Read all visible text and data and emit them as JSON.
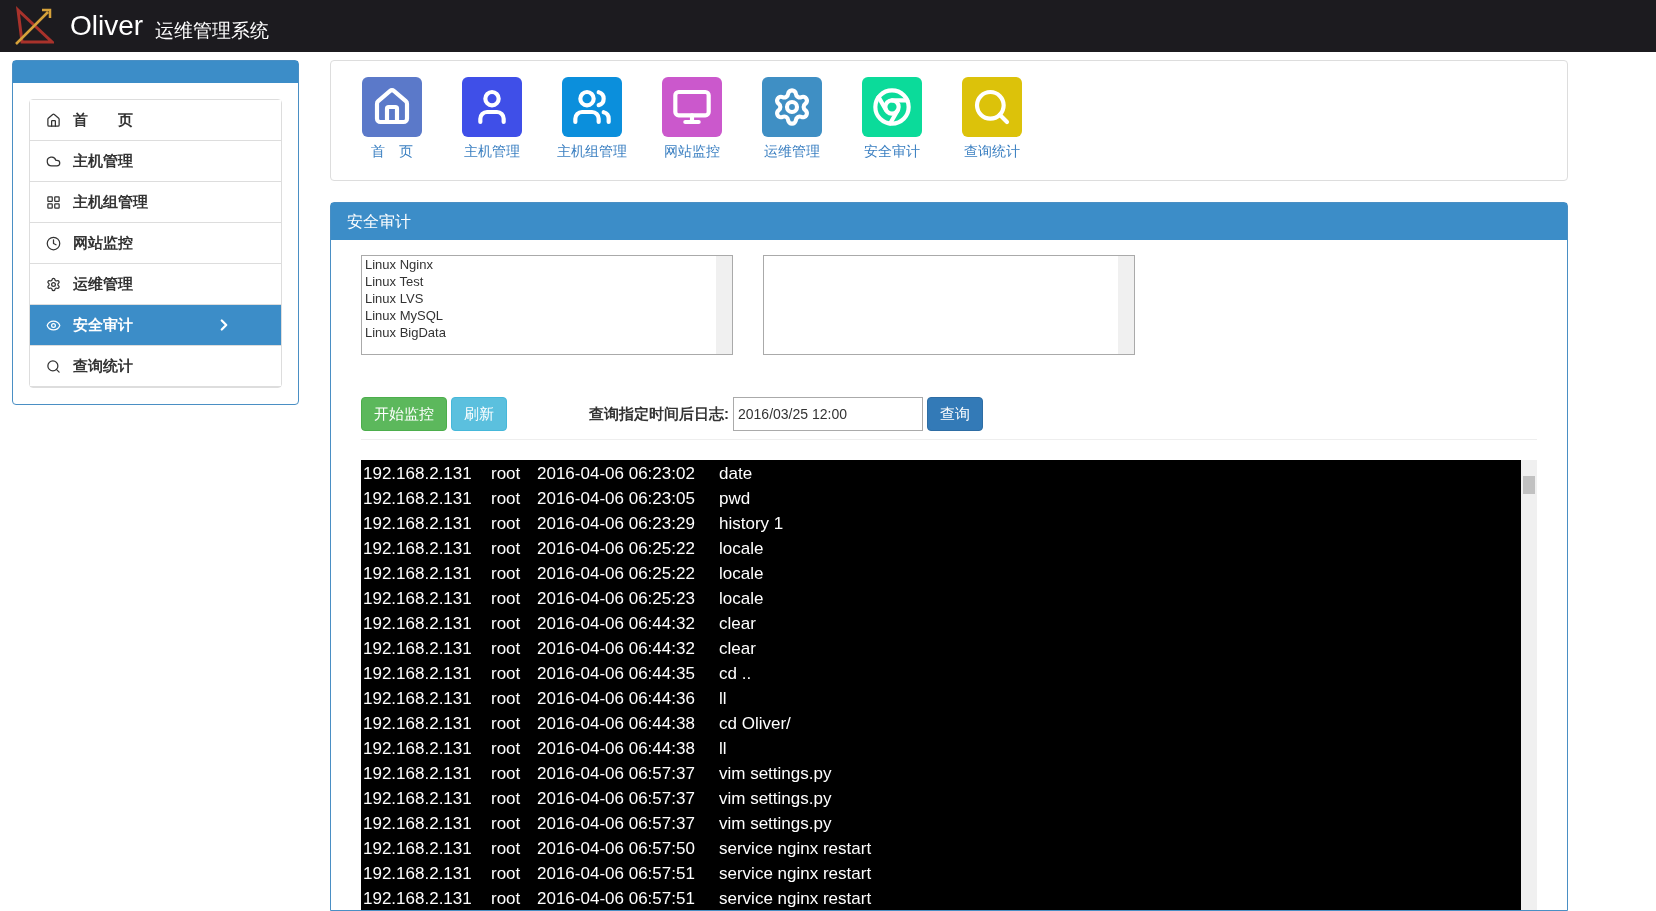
{
  "header": {
    "brand": "Oliver",
    "subtitle": "运维管理系统"
  },
  "sidebar": {
    "items": [
      {
        "label": "首　　页",
        "selected": false
      },
      {
        "label": "主机管理",
        "selected": false
      },
      {
        "label": "主机组管理",
        "selected": false
      },
      {
        "label": "网站监控",
        "selected": false
      },
      {
        "label": "运维管理",
        "selected": false
      },
      {
        "label": "安全审计",
        "selected": true
      },
      {
        "label": "查询统计",
        "selected": false
      }
    ]
  },
  "shortcuts": [
    {
      "label": "首　页",
      "color": "#5b79c9"
    },
    {
      "label": "主机管理",
      "color": "#3f4fe8"
    },
    {
      "label": "主机组管理",
      "color": "#0b8fdc"
    },
    {
      "label": "网站监控",
      "color": "#cb58cc"
    },
    {
      "label": "运维管理",
      "color": "#3f8fc4"
    },
    {
      "label": "安全审计",
      "color": "#0bdb9a"
    },
    {
      "label": "查询统计",
      "color": "#dcc20a"
    }
  ],
  "panel": {
    "title": "安全审计",
    "host_list": [
      "Linux Nginx",
      "Linux Test",
      "Linux LVS",
      "Linux MySQL",
      "Linux BigData"
    ],
    "start_button": "开始监控",
    "refresh_button": "刷新",
    "query_label": "查询指定时间后日志:",
    "query_time": {
      "value": "2016/03/25 12:00"
    },
    "query_button": "查询",
    "log_rows": [
      {
        "ip": "192.168.2.131",
        "user": "root",
        "time": "2016-04-06 06:23:02",
        "command": "date"
      },
      {
        "ip": "192.168.2.131",
        "user": "root",
        "time": "2016-04-06 06:23:05",
        "command": "pwd"
      },
      {
        "ip": "192.168.2.131",
        "user": "root",
        "time": "2016-04-06 06:23:29",
        "command": "history 1"
      },
      {
        "ip": "192.168.2.131",
        "user": "root",
        "time": "2016-04-06 06:25:22",
        "command": "locale"
      },
      {
        "ip": "192.168.2.131",
        "user": "root",
        "time": "2016-04-06 06:25:22",
        "command": "locale"
      },
      {
        "ip": "192.168.2.131",
        "user": "root",
        "time": "2016-04-06 06:25:23",
        "command": "locale"
      },
      {
        "ip": "192.168.2.131",
        "user": "root",
        "time": "2016-04-06 06:44:32",
        "command": "clear"
      },
      {
        "ip": "192.168.2.131",
        "user": "root",
        "time": "2016-04-06 06:44:32",
        "command": "clear"
      },
      {
        "ip": "192.168.2.131",
        "user": "root",
        "time": "2016-04-06 06:44:35",
        "command": "cd .."
      },
      {
        "ip": "192.168.2.131",
        "user": "root",
        "time": "2016-04-06 06:44:36",
        "command": "ll"
      },
      {
        "ip": "192.168.2.131",
        "user": "root",
        "time": "2016-04-06 06:44:38",
        "command": "cd Oliver/"
      },
      {
        "ip": "192.168.2.131",
        "user": "root",
        "time": "2016-04-06 06:44:38",
        "command": "ll"
      },
      {
        "ip": "192.168.2.131",
        "user": "root",
        "time": "2016-04-06 06:57:37",
        "command": "vim settings.py"
      },
      {
        "ip": "192.168.2.131",
        "user": "root",
        "time": "2016-04-06 06:57:37",
        "command": "vim settings.py"
      },
      {
        "ip": "192.168.2.131",
        "user": "root",
        "time": "2016-04-06 06:57:37",
        "command": "vim settings.py"
      },
      {
        "ip": "192.168.2.131",
        "user": "root",
        "time": "2016-04-06 06:57:50",
        "command": "service nginx restart"
      },
      {
        "ip": "192.168.2.131",
        "user": "root",
        "time": "2016-04-06 06:57:51",
        "command": "service nginx restart"
      },
      {
        "ip": "192.168.2.131",
        "user": "root",
        "time": "2016-04-06 06:57:51",
        "command": "service nginx restart"
      }
    ]
  }
}
